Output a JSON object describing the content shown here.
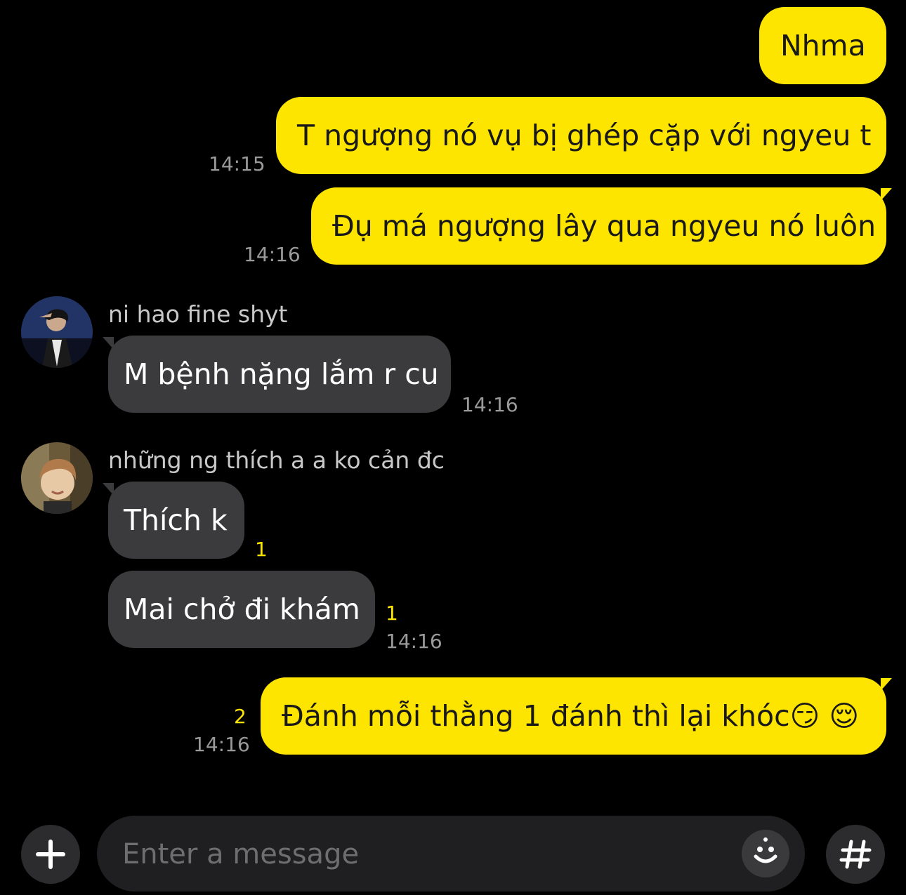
{
  "messages": [
    {
      "side": "me",
      "text": "Nhma",
      "time": ""
    },
    {
      "side": "me",
      "text": "T ngượng nó vụ bị ghép cặp với ngyeu t",
      "time": "14:15"
    },
    {
      "side": "me",
      "text": "Đụ má ngượng lây qua ngyeu nó luôn",
      "time": "14:16"
    },
    {
      "side": "them",
      "sender": "ni hao fine shyt",
      "text": "M bệnh nặng lắm r cu",
      "time": "14:16"
    },
    {
      "side": "them",
      "sender": "những ng thích a a ko cản đc",
      "text": "Thích k",
      "unread": "1"
    },
    {
      "side": "them",
      "text": "Mai chở đi khám",
      "unread": "1",
      "time": "14:16"
    },
    {
      "side": "me",
      "text": "Đánh mỗi thằng 1 đánh thì lại khóc😏 😌",
      "unread": "2",
      "time": "14:16"
    }
  ],
  "input": {
    "placeholder": "Enter a message",
    "add_icon": "plus-icon",
    "emoji_icon": "emoji-icon",
    "hashtag_icon": "hash-icon"
  },
  "colors": {
    "background": "#000000",
    "my_bubble": "#fee500",
    "their_bubble": "#3b3b3d",
    "unread": "#fee500",
    "time": "#9a9a9a"
  }
}
